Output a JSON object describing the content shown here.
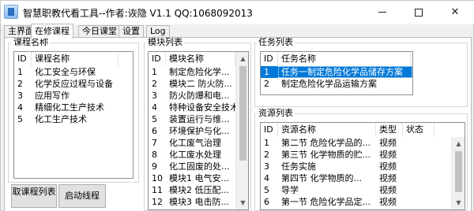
{
  "window": {
    "title": "智慧职教代看工具--作者:诙隐 V1.1 QQ:1068092013",
    "minimize_icon": "minimize-icon",
    "maximize_icon": "maximize-icon",
    "close_icon": "close-icon",
    "close_glyph": "✕"
  },
  "tabs": [
    "主界面",
    "在修课程",
    "今日课堂",
    "设置",
    "Log"
  ],
  "active_tab": "在修课程",
  "courses": {
    "label": "课程名称",
    "columns": [
      "ID",
      "课程名称"
    ],
    "rows": [
      [
        "1",
        "化工安全与环保"
      ],
      [
        "2",
        "化学反应过程与设备"
      ],
      [
        "3",
        "应用写作"
      ],
      [
        "4",
        "精细化工生产技术"
      ],
      [
        "5",
        "化工生产技术"
      ]
    ]
  },
  "modules": {
    "label": "模块列表",
    "columns": [
      "ID",
      "模块名称"
    ],
    "rows": [
      [
        "1",
        "制定危险化学..."
      ],
      [
        "2",
        "模块二 防火防..."
      ],
      [
        "3",
        "防火防爆和电..."
      ],
      [
        "4",
        "特种设备安全技术"
      ],
      [
        "5",
        "装置运行与维..."
      ],
      [
        "6",
        "环境保护与化..."
      ],
      [
        "7",
        "化工废气治理"
      ],
      [
        "8",
        "化工废水处理"
      ],
      [
        "9",
        "化工固废的处..."
      ],
      [
        "10",
        "模块1 电气安..."
      ],
      [
        "11",
        "模块2 低压配..."
      ],
      [
        "12",
        "模块3 电击防..."
      ]
    ]
  },
  "tasks": {
    "label": "任务列表",
    "columns": [
      "ID",
      "任务名称"
    ],
    "rows": [
      [
        "1",
        "任务一制定危险化学品储存方案"
      ],
      [
        "2",
        "制定危险化学品运输方案"
      ]
    ],
    "selected_index": 0
  },
  "resources": {
    "label": "资源列表",
    "columns": [
      "ID",
      "资源名称",
      "类型",
      "状态"
    ],
    "rows": [
      [
        "1",
        "第二节 危险化学品的...",
        "视频",
        ""
      ],
      [
        "2",
        "第三节 化学物质的贮...",
        "视频",
        ""
      ],
      [
        "3",
        "任务实施",
        "视频",
        ""
      ],
      [
        "4",
        "第四节 化学物质的...",
        "视频",
        ""
      ],
      [
        "5",
        "导学",
        "视频",
        ""
      ],
      [
        "6",
        "第一节 危险化学品定...",
        "视频",
        ""
      ]
    ]
  },
  "buttons": {
    "fetch_courses": "取课程列表",
    "start_thread": "启动线程"
  },
  "icons": {
    "app": "app-icon",
    "scroll_up": "scroll-up-icon",
    "scroll_down": "scroll-down-icon"
  },
  "colors": {
    "selection": "#0078d7",
    "window_bg": "#f0f0f0"
  }
}
